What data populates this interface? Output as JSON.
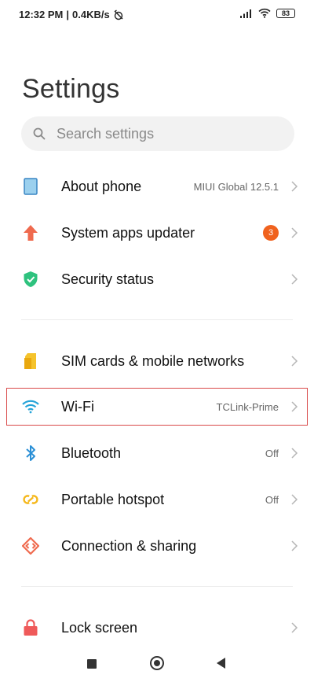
{
  "status": {
    "time": "12:32 PM",
    "speed": "0.4KB/s",
    "battery": "83"
  },
  "page": {
    "title": "Settings"
  },
  "search": {
    "placeholder": "Search settings"
  },
  "items": [
    {
      "label": "About phone",
      "value": "MIUI Global 12.5.1"
    },
    {
      "label": "System apps updater",
      "badge": "3"
    },
    {
      "label": "Security status"
    },
    {
      "label": "SIM cards & mobile networks"
    },
    {
      "label": "Wi-Fi",
      "value": "TCLink-Prime"
    },
    {
      "label": "Bluetooth",
      "value": "Off"
    },
    {
      "label": "Portable hotspot",
      "value": "Off"
    },
    {
      "label": "Connection & sharing"
    },
    {
      "label": "Lock screen"
    }
  ],
  "colors": {
    "accent": "#f0621e",
    "wifi": "#27a4d8",
    "security": "#2ec27e",
    "sim": "#f5c32c",
    "highlight": "#d94a4a"
  }
}
